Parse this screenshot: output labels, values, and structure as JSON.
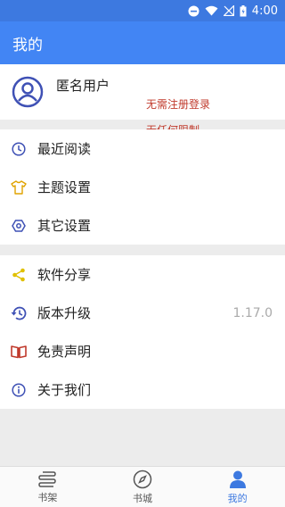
{
  "status": {
    "time": "4:00"
  },
  "app_bar": {
    "title": "我的"
  },
  "profile": {
    "name": "匿名用户",
    "note_line1": "无需注册登录",
    "note_line2": "无任何限制"
  },
  "menu_group1": [
    {
      "label": "最近阅读",
      "icon": "clock-icon"
    },
    {
      "label": "主题设置",
      "icon": "shirt-icon"
    },
    {
      "label": "其它设置",
      "icon": "hex-settings-icon"
    }
  ],
  "menu_group2": [
    {
      "label": "软件分享",
      "icon": "share-icon"
    },
    {
      "label": "版本升级",
      "icon": "history-icon",
      "value": "1.17.0"
    },
    {
      "label": "免责声明",
      "icon": "book-icon"
    },
    {
      "label": "关于我们",
      "icon": "info-icon"
    }
  ],
  "bottom_nav": {
    "items": [
      {
        "label": "书架",
        "icon": "bookshelf-icon"
      },
      {
        "label": "书城",
        "icon": "compass-icon"
      },
      {
        "label": "我的",
        "icon": "person-icon"
      }
    ],
    "active_index": 2
  },
  "colors": {
    "primary": "#4285f4",
    "accent_red": "#c0392b",
    "icon_blue": "#3f51b5"
  }
}
